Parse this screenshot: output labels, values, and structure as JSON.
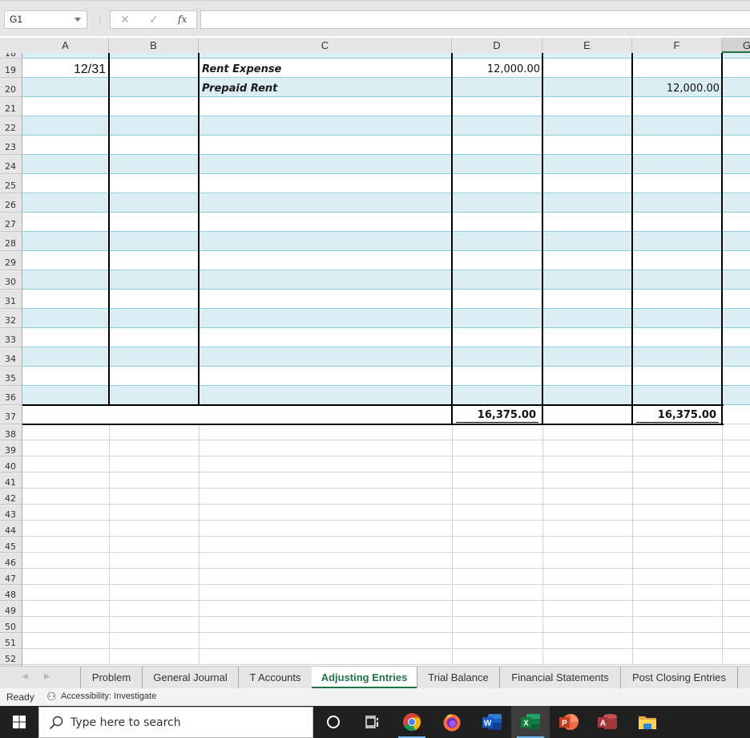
{
  "formula_bar": {
    "name_box": "G1",
    "cancel_icon": "✕",
    "enter_icon": "✓",
    "fx_label": "fx",
    "formula_value": ""
  },
  "columns": [
    "A",
    "B",
    "C",
    "D",
    "E",
    "F",
    "G"
  ],
  "selected_column": "G",
  "rows": {
    "partial_top": "18",
    "numbers": [
      "19",
      "20",
      "21",
      "22",
      "23",
      "24",
      "25",
      "26",
      "27",
      "28",
      "29",
      "30",
      "31",
      "32",
      "33",
      "34",
      "35",
      "36",
      "37",
      "38",
      "39",
      "40",
      "41",
      "42",
      "43",
      "44",
      "45",
      "46",
      "47",
      "48",
      "49",
      "50",
      "51",
      "52"
    ]
  },
  "journal": {
    "entries": [
      {
        "row": "19",
        "date": "12/31",
        "account": "Rent Expense",
        "debit": "12,000.00",
        "credit": ""
      },
      {
        "row": "20",
        "date": "",
        "account": "Prepaid Rent",
        "debit": "",
        "credit": "12,000.00"
      }
    ],
    "totals": {
      "row": "37",
      "debit": "16,375.00",
      "credit": "16,375.00"
    }
  },
  "sheet_tabs": {
    "nav_prev": "◀",
    "nav_next": "▶",
    "tabs": [
      {
        "label": "Problem",
        "active": false
      },
      {
        "label": "General Journal",
        "active": false
      },
      {
        "label": "T Accounts",
        "active": false
      },
      {
        "label": "Adjusting Entries",
        "active": true
      },
      {
        "label": "Trial Balance",
        "active": false
      },
      {
        "label": "Financial Statements",
        "active": false
      },
      {
        "label": "Post Closing Entries",
        "active": false
      }
    ]
  },
  "status_bar": {
    "mode": "Ready",
    "accessibility": "Accessibility: Investigate"
  },
  "taskbar": {
    "search_placeholder": "Type here to search",
    "apps": [
      {
        "name": "cortana",
        "label": "O"
      },
      {
        "name": "task-view",
        "label": ""
      },
      {
        "name": "chrome",
        "label": ""
      },
      {
        "name": "firefox",
        "label": ""
      },
      {
        "name": "word",
        "label": "W"
      },
      {
        "name": "excel",
        "label": "X"
      },
      {
        "name": "powerpoint",
        "label": "P"
      },
      {
        "name": "access",
        "label": "A"
      },
      {
        "name": "file-explorer",
        "label": ""
      }
    ]
  },
  "colors": {
    "excel_green": "#217346",
    "band_fill": "#daeef3",
    "band_line": "#92cddc"
  }
}
